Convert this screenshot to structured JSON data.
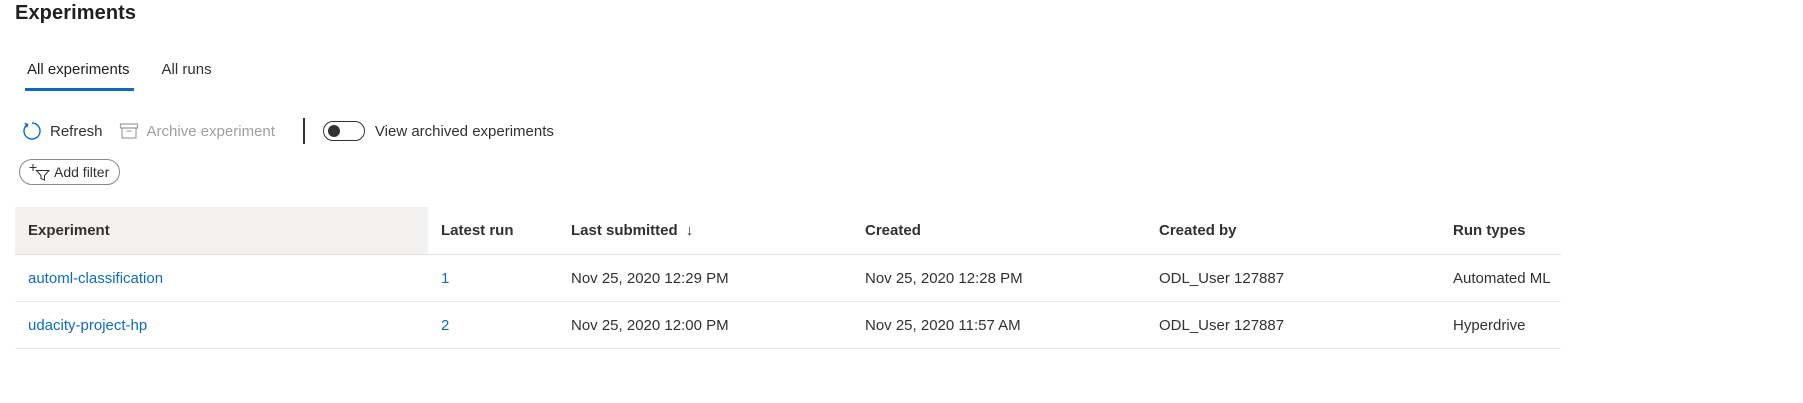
{
  "page": {
    "title": "Experiments"
  },
  "tabs": [
    {
      "label": "All experiments",
      "active": true
    },
    {
      "label": "All runs",
      "active": false
    }
  ],
  "toolbar": {
    "refresh_label": "Refresh",
    "refresh_icon": "refresh-icon",
    "archive_label": "Archive experiment",
    "archive_icon": "archive-icon",
    "archive_disabled": true,
    "view_archived_label": "View archived experiments",
    "view_archived_on": false
  },
  "filter": {
    "add_filter_label": "Add filter",
    "icon": "add-filter-icon"
  },
  "table": {
    "columns": [
      "Experiment",
      "Latest run",
      "Last submitted",
      "Created",
      "Created by",
      "Run types"
    ],
    "sort": {
      "column": "Last submitted",
      "direction": "descending",
      "indicator": "↓"
    },
    "rows": [
      {
        "experiment": "automl-classification",
        "latest_run": "1",
        "last_submitted": "Nov 25, 2020 12:29 PM",
        "created": "Nov 25, 2020 12:28 PM",
        "created_by": "ODL_User 127887",
        "run_types": "Automated ML"
      },
      {
        "experiment": "udacity-project-hp",
        "latest_run": "2",
        "last_submitted": "Nov 25, 2020 12:00 PM",
        "created": "Nov 25, 2020 11:57 AM",
        "created_by": "ODL_User 127887",
        "run_types": "Hyperdrive"
      }
    ]
  },
  "colors": {
    "accent": "#0f6cbd",
    "text": "#323130",
    "disabled_text": "#a19f9d",
    "header_highlight": "#f3f2f1"
  }
}
